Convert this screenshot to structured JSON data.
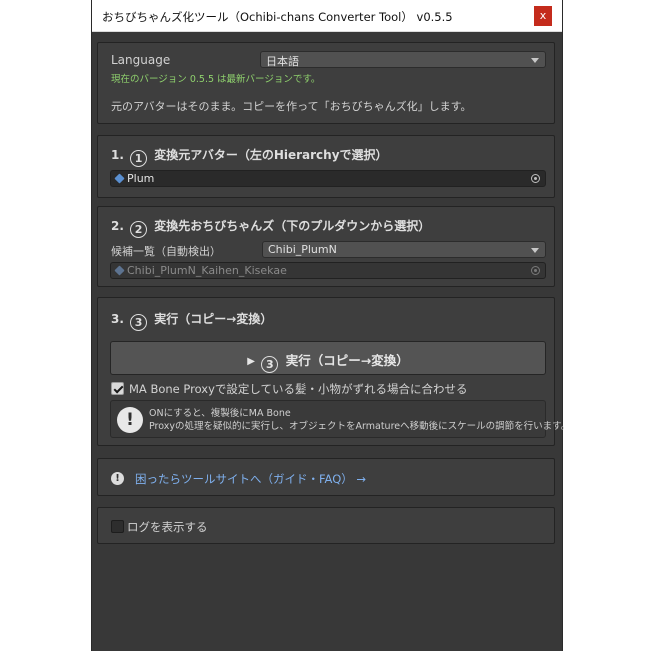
{
  "window": {
    "title": "おちびちゃんズ化ツール（Ochibi-chans Converter Tool） v0.5.5",
    "close_label": "x"
  },
  "header_panel": {
    "language_label": "Language",
    "language_value": "日本語",
    "version_status": "現在のバージョン 0.5.5 は最新バージョンです。",
    "description": "元のアバターはそのまま。コピーを作って「おちびちゃんズ化」します。"
  },
  "step1": {
    "num": "1.",
    "circle": "1",
    "title": "変換元アバター（左のHierarchyで選択）",
    "object_value": "Plum"
  },
  "step2": {
    "num": "2.",
    "circle": "2",
    "title": "変換先おちびちゃんズ（下のプルダウンから選択）",
    "candidates_label": "候補一覧（自動検出）",
    "candidates_value": "Chibi_PlumN",
    "object_value": "Chibi_PlumN_Kaihen_Kisekae"
  },
  "step3": {
    "num": "3.",
    "circle": "3",
    "title": "実行（コピー→変換）",
    "run_arrow": "▶",
    "run_circle": "3",
    "run_label": "実行（コピー→変換）",
    "checkbox_label": "MA Bone Proxyで設定している髪・小物がずれる場合に合わせる",
    "checkbox_checked": true,
    "help_line1": "ONにすると、複製後にMA Bone",
    "help_line2": "Proxyの処理を疑似的に実行し、オブジェクトをArmatureへ移動後にスケールの調節を行います。"
  },
  "help_link": {
    "icon": "!",
    "label": "困ったらツールサイトへ（ガイド・FAQ） →"
  },
  "log_panel": {
    "label": "ログを表示する",
    "checked": false
  },
  "colors": {
    "panel_bg": "#3e3e3e",
    "window_bg": "#383838",
    "status_green": "#8fd16d",
    "link_blue": "#7fb0ee",
    "close_red": "#c42b1c"
  }
}
